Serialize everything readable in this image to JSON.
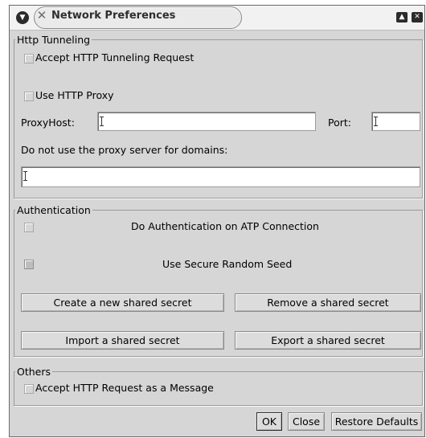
{
  "window": {
    "title": "Network Preferences",
    "icons": {
      "menu": "chevron-down-icon",
      "app": "x-logo-icon",
      "maximize": "maximize-icon",
      "close": "close-icon"
    }
  },
  "http_tunneling": {
    "legend": "Http Tunneling",
    "accept_request": {
      "label": "Accept HTTP Tunneling Request",
      "checked": false
    },
    "use_proxy": {
      "label": "Use HTTP Proxy",
      "checked": false
    },
    "proxy_host": {
      "label": "ProxyHost:",
      "value": ""
    },
    "port": {
      "label": "Port:",
      "value": ""
    },
    "no_proxy": {
      "label": "Do not use the proxy server for domains:",
      "value": ""
    }
  },
  "authentication": {
    "legend": "Authentication",
    "do_auth": {
      "label": "Do Authentication on ATP Connection",
      "checked": false
    },
    "secure_seed": {
      "label": "Use Secure Random Seed",
      "checked": false,
      "enabled": false
    },
    "buttons": {
      "create": "Create a new shared secret",
      "remove": "Remove a shared secret",
      "import": "Import a shared secret",
      "export": "Export a shared secret"
    }
  },
  "others": {
    "legend": "Others",
    "accept_message": {
      "label": "Accept HTTP Request as a Message",
      "checked": false
    }
  },
  "footer": {
    "ok": "OK",
    "close": "Close",
    "restore": "Restore Defaults"
  }
}
